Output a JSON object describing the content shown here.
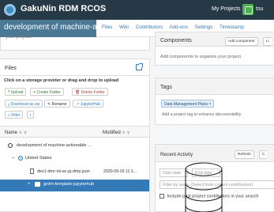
{
  "navbar": {
    "brand": "GakuNin RDM RCOS",
    "my_projects": "My Projects",
    "user": "tsu"
  },
  "project": {
    "title": "development of machine-acti...",
    "nav": [
      "Files",
      "Wiki",
      "Contributors",
      "Add-ons",
      "Settings",
      "Timestamp"
    ],
    "description_fragment": "your project."
  },
  "files": {
    "heading": "Files",
    "instruction": "Click on a storage provider or drag and drop to upload",
    "buttons": {
      "upload": "Upload",
      "create_folder": "Create Folder",
      "delete_folder": "Delete Folder",
      "download_zip": "Download as zip",
      "rename": "Rename",
      "jupyterhub": "JupyterHub",
      "filter": "Filter"
    },
    "columns": {
      "name": "Name",
      "modified": "Modified"
    },
    "tree": [
      {
        "label": "development of machine-actionable ...",
        "modified": ""
      },
      {
        "label": "United States",
        "modified": ""
      },
      {
        "label": "dev1-dmr-nii-ac-jp.dmp.json",
        "modified": "2020-09-29 11:1..."
      },
      {
        "label": "grdm-template-jupyterhub",
        "modified": ""
      }
    ]
  },
  "components": {
    "heading": "Components",
    "add_button": "Add component",
    "link_fragment": "Li",
    "empty_text": "Add components to organize your project."
  },
  "tags": {
    "heading": "Tags",
    "tag": "Data Management Plans",
    "placeholder": "Add a project tag to enhance discoverability"
  },
  "activity": {
    "heading": "Recent Activity",
    "refresh": "Refresh",
    "extra_button": "C",
    "start_date": "Start date",
    "end_date": "End date",
    "filter_placeholder": "Filter by users (Select from current contributors)",
    "include_text": "Include past project contributors in your search"
  }
}
